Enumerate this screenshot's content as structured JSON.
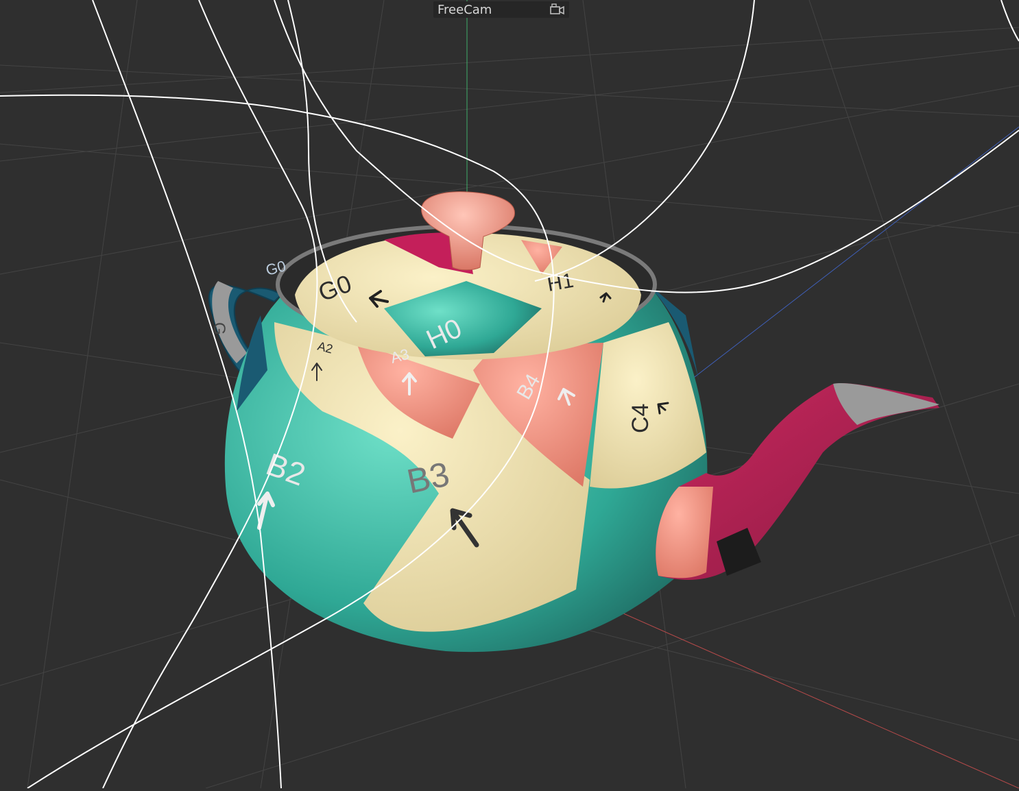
{
  "viewport": {
    "camera_name": "FreeCam",
    "camera_icon": "camera-icon",
    "background_color": "#2f2f2f",
    "grid_color": "#454545",
    "axis_colors": {
      "x": "#b84a4a",
      "y": "#3fae6a",
      "z": "#3f5fb8"
    },
    "object": "teapot",
    "uv_labels": {
      "lid_g0": "G0",
      "lid_h0": "H0",
      "lid_h1": "H1",
      "rim_a2": "A2",
      "body_a3": "A3",
      "body_b2": "B2",
      "body_b3": "B3",
      "body_b4": "B4",
      "body_c4": "C4",
      "handle_g0": "G0",
      "handle_g": "G"
    }
  }
}
